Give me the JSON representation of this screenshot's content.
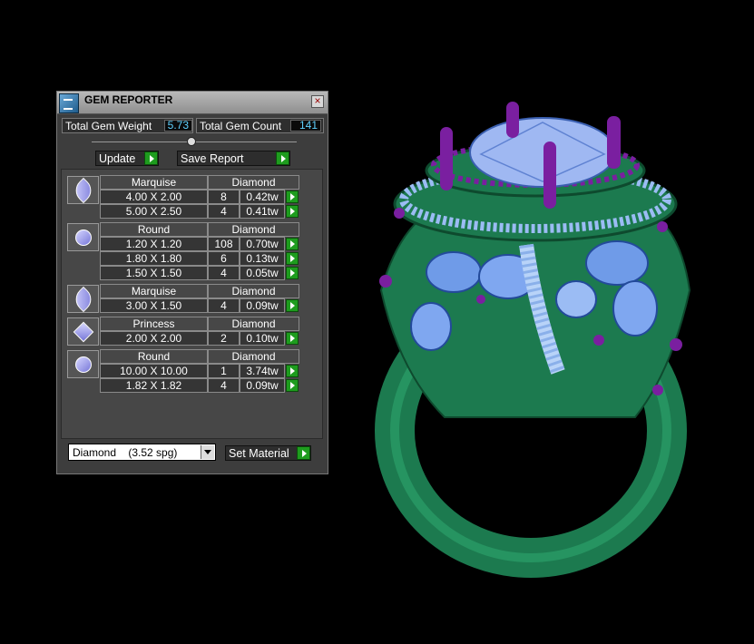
{
  "window": {
    "title": "GEM REPORTER",
    "close_label": "×"
  },
  "summary": {
    "total_weight_label": "Total Gem Weight",
    "total_weight_value": "5.73",
    "total_count_label": "Total Gem Count",
    "total_count_value": "141"
  },
  "buttons": {
    "update": "Update",
    "save_report": "Save Report",
    "set_material": "Set Material"
  },
  "groups": [
    {
      "shape": "Marquise",
      "material": "Diamond",
      "icon": "marquise-gem-icon",
      "rows": [
        {
          "size": "4.00 X 2.00",
          "count": "8",
          "weight": "0.42tw"
        },
        {
          "size": "5.00 X 2.50",
          "count": "4",
          "weight": "0.41tw"
        }
      ]
    },
    {
      "shape": "Round",
      "material": "Diamond",
      "icon": "round-gem-icon",
      "rows": [
        {
          "size": "1.20 X 1.20",
          "count": "108",
          "weight": "0.70tw"
        },
        {
          "size": "1.80 X 1.80",
          "count": "6",
          "weight": "0.13tw"
        },
        {
          "size": "1.50 X 1.50",
          "count": "4",
          "weight": "0.05tw"
        }
      ]
    },
    {
      "shape": "Marquise",
      "material": "Diamond",
      "icon": "marquise-gem-icon",
      "rows": [
        {
          "size": "3.00 X 1.50",
          "count": "4",
          "weight": "0.09tw"
        }
      ]
    },
    {
      "shape": "Princess",
      "material": "Diamond",
      "icon": "princess-gem-icon",
      "rows": [
        {
          "size": "2.00 X 2.00",
          "count": "2",
          "weight": "0.10tw"
        }
      ]
    },
    {
      "shape": "Round",
      "material": "Diamond",
      "icon": "round-gem-icon",
      "rows": [
        {
          "size": "10.00 X 10.00",
          "count": "1",
          "weight": "3.74tw"
        },
        {
          "size": "1.82 X 1.82",
          "count": "4",
          "weight": "0.09tw"
        }
      ]
    }
  ],
  "material_select": {
    "value": "Diamond    (3.52 spg)"
  },
  "colors": {
    "accent_green": "#1e9c1e",
    "value_cyan": "#5fd1ff",
    "ring_green": "#1f8a5a",
    "gem_blue": "#7fa7f0",
    "prong_purple": "#7a1fa0"
  },
  "viewport": {
    "model": "ring-3d-render"
  }
}
